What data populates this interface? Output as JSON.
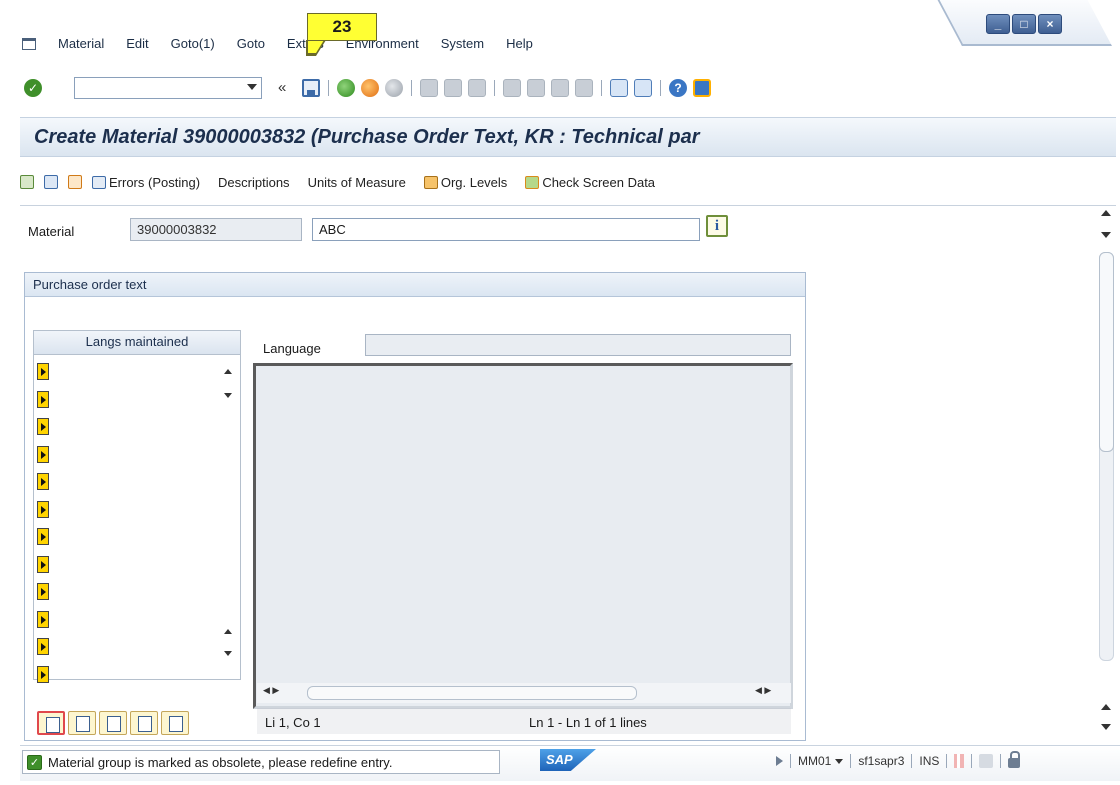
{
  "menu": {
    "items": [
      "Material",
      "Edit",
      "Goto(1)",
      "Goto",
      "Extras",
      "Environment",
      "System",
      "Help"
    ],
    "window_buttons": [
      "minimize",
      "maximize",
      "close"
    ]
  },
  "tooltip": {
    "number": "23"
  },
  "toolbar": {
    "command_field": "",
    "icons": [
      "enter-icon",
      "save-icon",
      "back-icon",
      "exit-icon",
      "cancel-icon",
      "print-icon",
      "find-icon",
      "find-next-icon",
      "first-page-icon",
      "previous-page-icon",
      "next-page-icon",
      "last-page-icon",
      "create-session-icon",
      "shortcut-icon",
      "help-icon",
      "customize-layout-icon"
    ]
  },
  "title": "Create Material 39000003832 (Purchase Order Text, KR : Technical par",
  "app_toolbar": {
    "errors": "Errors (Posting)",
    "descriptions": "Descriptions",
    "units": "Units of Measure",
    "org_levels": "Org. Levels",
    "check": "Check Screen Data"
  },
  "material": {
    "label": "Material",
    "number": "39000003832",
    "description": "ABC"
  },
  "purchase_text": {
    "title": "Purchase order text",
    "langs_header": "Langs maintained",
    "lang_rows": 12,
    "language_label": "Language",
    "language_value": "",
    "position": "Li 1, Co 1",
    "lines": "Ln 1 - Ln 1 of 1 lines"
  },
  "status": {
    "message": "Material group  is marked as obsolete, please redefine entry.",
    "logo": "SAP",
    "transaction": "MM01",
    "server": "sf1sapr3",
    "mode": "INS"
  },
  "colors": {
    "title_text": "#1c2f4d",
    "accent_blue": "#3d6ba8",
    "success_green": "#3f8f2a",
    "tooltip_yellow": "#ffff33"
  }
}
